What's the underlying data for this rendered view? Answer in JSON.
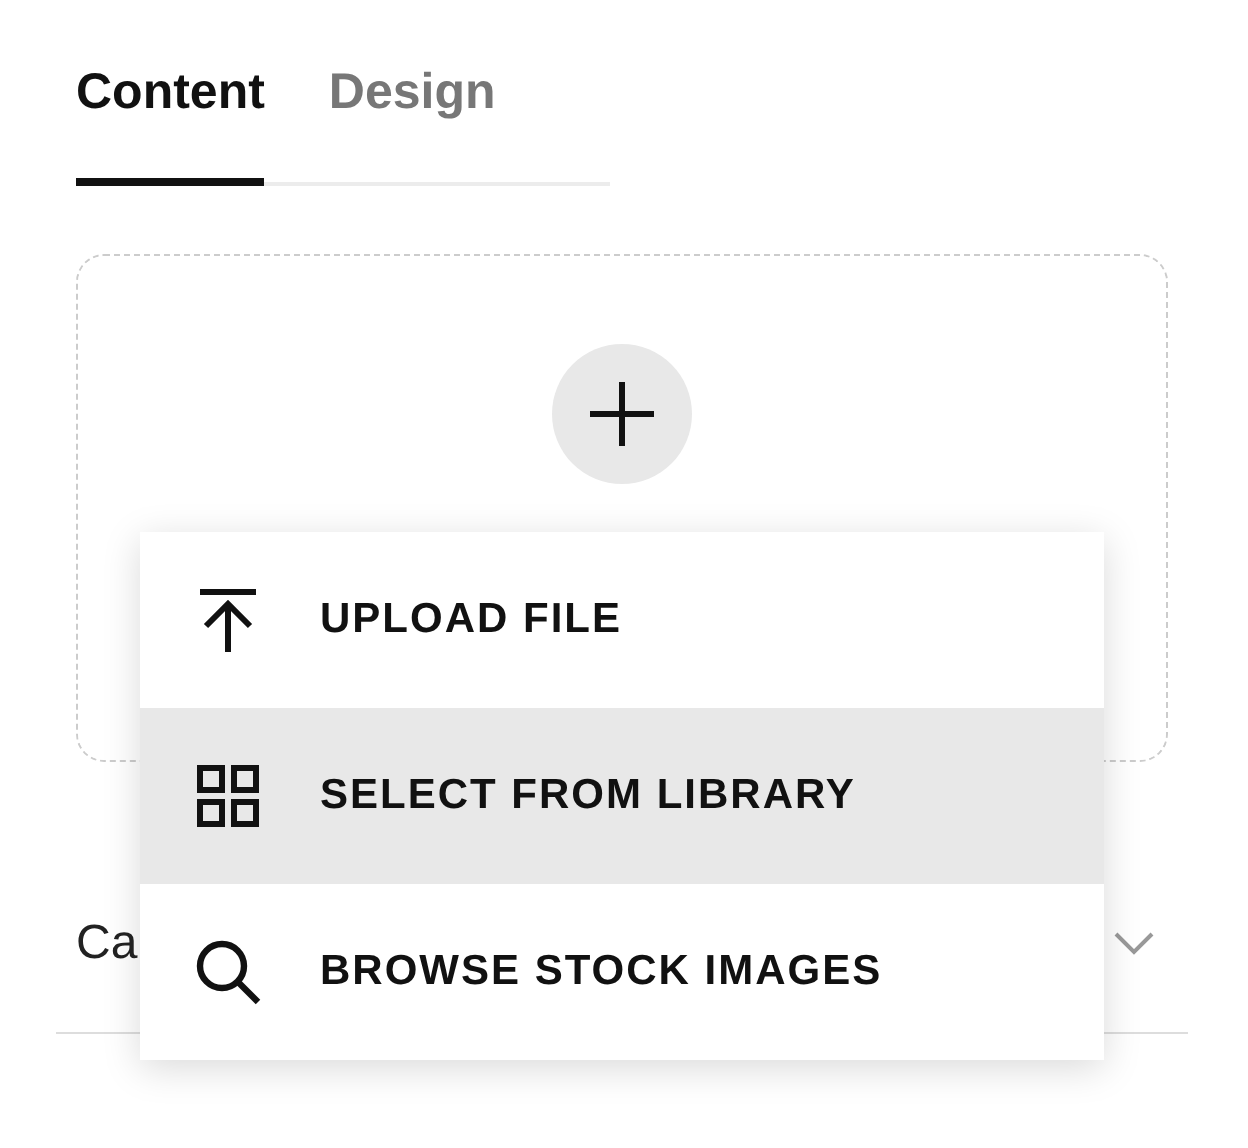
{
  "tabs": [
    {
      "label": "Content",
      "selected": true
    },
    {
      "label": "Design",
      "selected": false
    }
  ],
  "image_area": {
    "kind": "add"
  },
  "field_row": {
    "label": "Ca",
    "expanded": false
  },
  "menu": {
    "items": [
      {
        "kind": "upload",
        "label": "UPLOAD FILE",
        "selected": false
      },
      {
        "kind": "library",
        "label": "SELECT FROM LIBRARY",
        "selected": true
      },
      {
        "kind": "search",
        "label": "BROWSE STOCK IMAGES",
        "selected": false
      }
    ]
  }
}
